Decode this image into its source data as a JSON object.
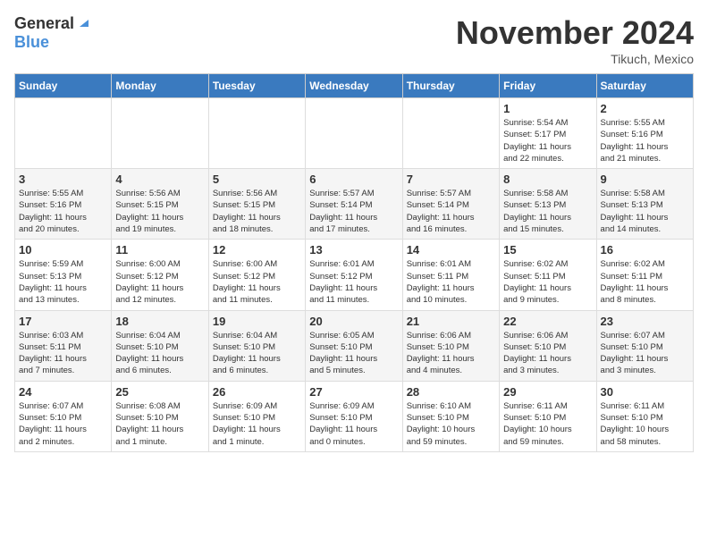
{
  "header": {
    "logo_general": "General",
    "logo_blue": "Blue",
    "month": "November 2024",
    "location": "Tikuch, Mexico"
  },
  "days_of_week": [
    "Sunday",
    "Monday",
    "Tuesday",
    "Wednesday",
    "Thursday",
    "Friday",
    "Saturday"
  ],
  "weeks": [
    [
      {
        "day": "",
        "info": ""
      },
      {
        "day": "",
        "info": ""
      },
      {
        "day": "",
        "info": ""
      },
      {
        "day": "",
        "info": ""
      },
      {
        "day": "",
        "info": ""
      },
      {
        "day": "1",
        "info": "Sunrise: 5:54 AM\nSunset: 5:17 PM\nDaylight: 11 hours\nand 22 minutes."
      },
      {
        "day": "2",
        "info": "Sunrise: 5:55 AM\nSunset: 5:16 PM\nDaylight: 11 hours\nand 21 minutes."
      }
    ],
    [
      {
        "day": "3",
        "info": "Sunrise: 5:55 AM\nSunset: 5:16 PM\nDaylight: 11 hours\nand 20 minutes."
      },
      {
        "day": "4",
        "info": "Sunrise: 5:56 AM\nSunset: 5:15 PM\nDaylight: 11 hours\nand 19 minutes."
      },
      {
        "day": "5",
        "info": "Sunrise: 5:56 AM\nSunset: 5:15 PM\nDaylight: 11 hours\nand 18 minutes."
      },
      {
        "day": "6",
        "info": "Sunrise: 5:57 AM\nSunset: 5:14 PM\nDaylight: 11 hours\nand 17 minutes."
      },
      {
        "day": "7",
        "info": "Sunrise: 5:57 AM\nSunset: 5:14 PM\nDaylight: 11 hours\nand 16 minutes."
      },
      {
        "day": "8",
        "info": "Sunrise: 5:58 AM\nSunset: 5:13 PM\nDaylight: 11 hours\nand 15 minutes."
      },
      {
        "day": "9",
        "info": "Sunrise: 5:58 AM\nSunset: 5:13 PM\nDaylight: 11 hours\nand 14 minutes."
      }
    ],
    [
      {
        "day": "10",
        "info": "Sunrise: 5:59 AM\nSunset: 5:13 PM\nDaylight: 11 hours\nand 13 minutes."
      },
      {
        "day": "11",
        "info": "Sunrise: 6:00 AM\nSunset: 5:12 PM\nDaylight: 11 hours\nand 12 minutes."
      },
      {
        "day": "12",
        "info": "Sunrise: 6:00 AM\nSunset: 5:12 PM\nDaylight: 11 hours\nand 11 minutes."
      },
      {
        "day": "13",
        "info": "Sunrise: 6:01 AM\nSunset: 5:12 PM\nDaylight: 11 hours\nand 11 minutes."
      },
      {
        "day": "14",
        "info": "Sunrise: 6:01 AM\nSunset: 5:11 PM\nDaylight: 11 hours\nand 10 minutes."
      },
      {
        "day": "15",
        "info": "Sunrise: 6:02 AM\nSunset: 5:11 PM\nDaylight: 11 hours\nand 9 minutes."
      },
      {
        "day": "16",
        "info": "Sunrise: 6:02 AM\nSunset: 5:11 PM\nDaylight: 11 hours\nand 8 minutes."
      }
    ],
    [
      {
        "day": "17",
        "info": "Sunrise: 6:03 AM\nSunset: 5:11 PM\nDaylight: 11 hours\nand 7 minutes."
      },
      {
        "day": "18",
        "info": "Sunrise: 6:04 AM\nSunset: 5:10 PM\nDaylight: 11 hours\nand 6 minutes."
      },
      {
        "day": "19",
        "info": "Sunrise: 6:04 AM\nSunset: 5:10 PM\nDaylight: 11 hours\nand 6 minutes."
      },
      {
        "day": "20",
        "info": "Sunrise: 6:05 AM\nSunset: 5:10 PM\nDaylight: 11 hours\nand 5 minutes."
      },
      {
        "day": "21",
        "info": "Sunrise: 6:06 AM\nSunset: 5:10 PM\nDaylight: 11 hours\nand 4 minutes."
      },
      {
        "day": "22",
        "info": "Sunrise: 6:06 AM\nSunset: 5:10 PM\nDaylight: 11 hours\nand 3 minutes."
      },
      {
        "day": "23",
        "info": "Sunrise: 6:07 AM\nSunset: 5:10 PM\nDaylight: 11 hours\nand 3 minutes."
      }
    ],
    [
      {
        "day": "24",
        "info": "Sunrise: 6:07 AM\nSunset: 5:10 PM\nDaylight: 11 hours\nand 2 minutes."
      },
      {
        "day": "25",
        "info": "Sunrise: 6:08 AM\nSunset: 5:10 PM\nDaylight: 11 hours\nand 1 minute."
      },
      {
        "day": "26",
        "info": "Sunrise: 6:09 AM\nSunset: 5:10 PM\nDaylight: 11 hours\nand 1 minute."
      },
      {
        "day": "27",
        "info": "Sunrise: 6:09 AM\nSunset: 5:10 PM\nDaylight: 11 hours\nand 0 minutes."
      },
      {
        "day": "28",
        "info": "Sunrise: 6:10 AM\nSunset: 5:10 PM\nDaylight: 10 hours\nand 59 minutes."
      },
      {
        "day": "29",
        "info": "Sunrise: 6:11 AM\nSunset: 5:10 PM\nDaylight: 10 hours\nand 59 minutes."
      },
      {
        "day": "30",
        "info": "Sunrise: 6:11 AM\nSunset: 5:10 PM\nDaylight: 10 hours\nand 58 minutes."
      }
    ]
  ]
}
